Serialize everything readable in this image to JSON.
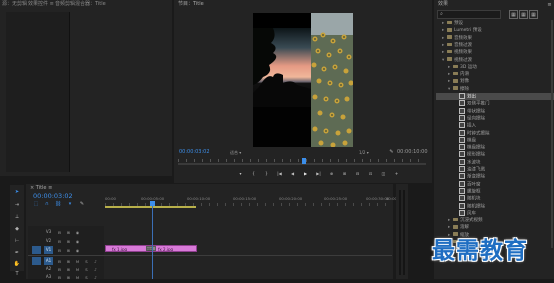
{
  "source_panel": {
    "title": "源：无剪辑",
    "effect_controls_tab": "效果控件",
    "tab_suffix": "≡",
    "audio_mixer_tab": "音频剪辑混合器：Title"
  },
  "program_monitor": {
    "title": "节目：Title",
    "timecode_left": "00:00:03:02",
    "fit_label": "适合",
    "quality_label": "1/2",
    "timecode_right": "00:00:10:00",
    "transport": [
      "▾",
      "{",
      "}",
      "|◀",
      "◀",
      "▶",
      "▶|",
      "⊕",
      "⊞",
      "⊟",
      "⊡",
      "◫",
      "+"
    ]
  },
  "effects_panel": {
    "title": "效果",
    "search_placeholder": "",
    "items": [
      {
        "label": "预设",
        "kind": "folder",
        "indent": 0,
        "expanded": false
      },
      {
        "label": "Lumetri 预设",
        "kind": "folder",
        "indent": 0,
        "expanded": false
      },
      {
        "label": "音频效果",
        "kind": "folder",
        "indent": 0,
        "expanded": false
      },
      {
        "label": "音频过渡",
        "kind": "folder",
        "indent": 0,
        "expanded": false
      },
      {
        "label": "视频效果",
        "kind": "folder",
        "indent": 0,
        "expanded": false
      },
      {
        "label": "视频过渡",
        "kind": "folder",
        "indent": 0,
        "expanded": true
      },
      {
        "label": "3D 运动",
        "kind": "folder",
        "indent": 1,
        "expanded": false
      },
      {
        "label": "内滑",
        "kind": "folder",
        "indent": 1,
        "expanded": false
      },
      {
        "label": "划像",
        "kind": "folder",
        "indent": 1,
        "expanded": false
      },
      {
        "label": "擦除",
        "kind": "folder",
        "indent": 1,
        "expanded": true
      },
      {
        "label": "划出",
        "kind": "effect",
        "indent": 2,
        "selected": true
      },
      {
        "label": "双侧平推门",
        "kind": "effect",
        "indent": 2
      },
      {
        "label": "带状擦除",
        "kind": "effect",
        "indent": 2
      },
      {
        "label": "径向擦除",
        "kind": "effect",
        "indent": 2
      },
      {
        "label": "插入",
        "kind": "effect",
        "indent": 2
      },
      {
        "label": "时钟式擦除",
        "kind": "effect",
        "indent": 2
      },
      {
        "label": "棋盘",
        "kind": "effect",
        "indent": 2
      },
      {
        "label": "棋盘擦除",
        "kind": "effect",
        "indent": 2
      },
      {
        "label": "楔形擦除",
        "kind": "effect",
        "indent": 2
      },
      {
        "label": "水波块",
        "kind": "effect",
        "indent": 2
      },
      {
        "label": "油漆飞溅",
        "kind": "effect",
        "indent": 2
      },
      {
        "label": "渐变擦除",
        "kind": "effect",
        "indent": 2
      },
      {
        "label": "百叶窗",
        "kind": "effect",
        "indent": 2
      },
      {
        "label": "螺旋框",
        "kind": "effect",
        "indent": 2
      },
      {
        "label": "随机块",
        "kind": "effect",
        "indent": 2
      },
      {
        "label": "随机擦除",
        "kind": "effect",
        "indent": 2
      },
      {
        "label": "风车",
        "kind": "effect",
        "indent": 2
      },
      {
        "label": "沉浸式视频",
        "kind": "folder",
        "indent": 1,
        "expanded": false
      },
      {
        "label": "溶解",
        "kind": "folder",
        "indent": 1,
        "expanded": false
      },
      {
        "label": "缩放",
        "kind": "folder",
        "indent": 1,
        "expanded": false
      },
      {
        "label": "页面剥落",
        "kind": "folder",
        "indent": 1,
        "expanded": false
      }
    ]
  },
  "timeline": {
    "tab_close": "×",
    "tab_label": "Title",
    "tab_menu": "≡",
    "timecode": "00:00:03:02",
    "ruler_labels": [
      "00:00",
      "00:00:05:00",
      "00:00:10:00",
      "00:00:15:00",
      "00:00:20:00",
      "00:00:25:00",
      "00:00:30:00",
      "00:00"
    ],
    "tracks": [
      {
        "name": "V3",
        "target": false
      },
      {
        "name": "V2",
        "target": false
      },
      {
        "name": "V1",
        "target": true
      },
      {
        "name": "A1",
        "target": true
      },
      {
        "name": "A2",
        "target": false
      },
      {
        "name": "A3",
        "target": false
      }
    ],
    "v1_clips": [
      {
        "label": "fx 1.jpg"
      },
      {
        "label": "fx 2.jpg"
      }
    ],
    "transition_label": "划出"
  },
  "watermark": "最需教育",
  "colors": {
    "accent": "#2c7fd6",
    "clip": "#d87ad8",
    "playhead": "#3b8eea"
  }
}
